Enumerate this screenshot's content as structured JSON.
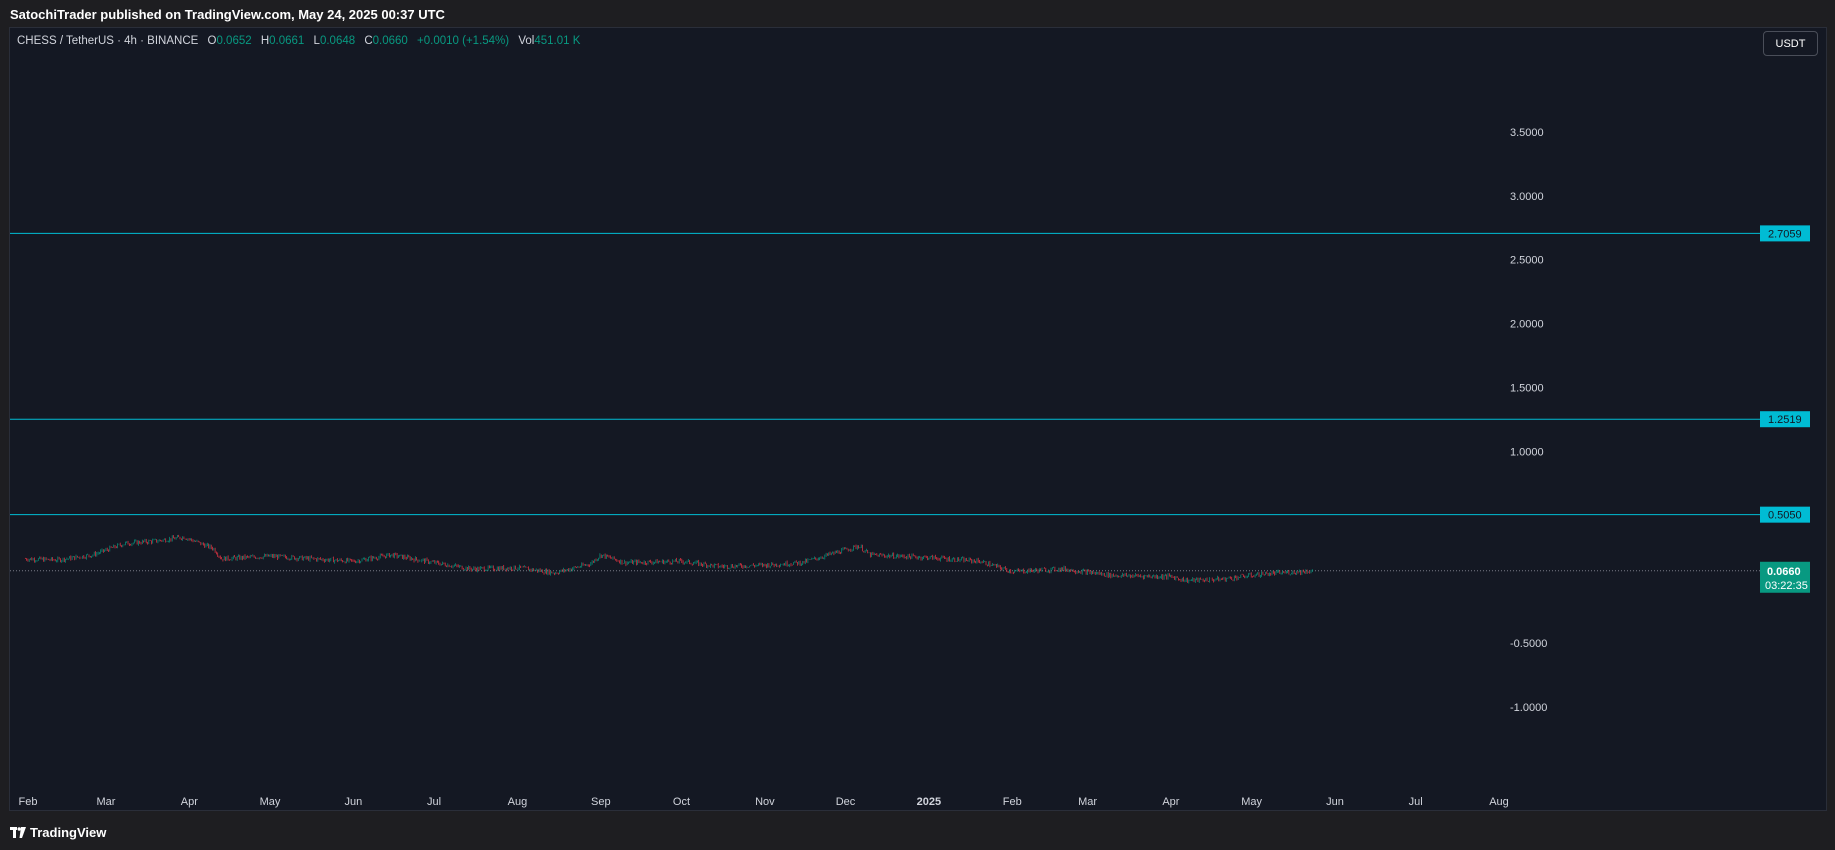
{
  "header": {
    "published": "SatochiTrader published on TradingView.com, May 24, 2025 00:37 UTC"
  },
  "legend": {
    "symbol": "CHESS / TetherUS · 4h · BINANCE",
    "open_label": "O",
    "open": "0.0652",
    "high_label": "H",
    "high": "0.0661",
    "low_label": "L",
    "low": "0.0648",
    "close_label": "C",
    "close": "0.0660",
    "change": "+0.0010 (+1.54%)",
    "vol_label": "Vol",
    "vol": "451.01 K"
  },
  "currency": "USDT",
  "footer": {
    "brand": "TradingView"
  },
  "colors": {
    "up": "#089981",
    "down": "#f23645",
    "level_line": "#00bcd4",
    "background": "#141823"
  },
  "chart_data": {
    "type": "candlestick",
    "title": "CHESS / TetherUS · 4h · BINANCE",
    "ylim": [
      -1.25,
      3.65
    ],
    "y_ticks": [
      "3.5000",
      "3.0000",
      "2.5000",
      "2.0000",
      "1.5000",
      "1.0000",
      "-0.5000",
      "-1.0000"
    ],
    "y_tick_values": [
      3.5,
      3.0,
      2.5,
      2.0,
      1.5,
      1.0,
      -0.5,
      -1.0
    ],
    "x_ticks": [
      "Feb",
      "Mar",
      "Apr",
      "May",
      "Jun",
      "Jul",
      "Aug",
      "Sep",
      "Oct",
      "Nov",
      "Dec",
      "2025",
      "Feb",
      "Mar",
      "Apr",
      "May",
      "Jun",
      "Jul",
      "Aug"
    ],
    "x_tick_dates": [
      "2024-02-01",
      "2024-03-01",
      "2024-04-01",
      "2024-05-01",
      "2024-06-01",
      "2024-07-01",
      "2024-08-01",
      "2024-09-01",
      "2024-10-01",
      "2024-11-01",
      "2024-12-01",
      "2025-01-01",
      "2025-02-01",
      "2025-03-01",
      "2025-04-01",
      "2025-05-01",
      "2025-06-01",
      "2025-07-01",
      "2025-08-01"
    ],
    "horizontal_levels": [
      {
        "label": "2.7059",
        "value": 2.7059
      },
      {
        "label": "1.2519",
        "value": 1.2519
      },
      {
        "label": "0.5050",
        "value": 0.505
      }
    ],
    "last_price": {
      "label": "0.0660",
      "value": 0.066,
      "countdown": "03:22:35"
    },
    "price_path": [
      {
        "date": "2024-01-31",
        "price": 0.16
      },
      {
        "date": "2024-02-12",
        "price": 0.15
      },
      {
        "date": "2024-02-25",
        "price": 0.19
      },
      {
        "date": "2024-03-08",
        "price": 0.28
      },
      {
        "date": "2024-03-20",
        "price": 0.3
      },
      {
        "date": "2024-03-30",
        "price": 0.33
      },
      {
        "date": "2024-04-10",
        "price": 0.24
      },
      {
        "date": "2024-04-13",
        "price": 0.16
      },
      {
        "date": "2024-05-01",
        "price": 0.18
      },
      {
        "date": "2024-06-01",
        "price": 0.14
      },
      {
        "date": "2024-06-15",
        "price": 0.19
      },
      {
        "date": "2024-07-01",
        "price": 0.13
      },
      {
        "date": "2024-07-15",
        "price": 0.08
      },
      {
        "date": "2024-08-01",
        "price": 0.09
      },
      {
        "date": "2024-08-15",
        "price": 0.05
      },
      {
        "date": "2024-08-28",
        "price": 0.12
      },
      {
        "date": "2024-09-01",
        "price": 0.19
      },
      {
        "date": "2024-09-10",
        "price": 0.13
      },
      {
        "date": "2024-10-01",
        "price": 0.14
      },
      {
        "date": "2024-10-15",
        "price": 0.1
      },
      {
        "date": "2024-11-01",
        "price": 0.11
      },
      {
        "date": "2024-11-15",
        "price": 0.13
      },
      {
        "date": "2024-12-01",
        "price": 0.23
      },
      {
        "date": "2024-12-06",
        "price": 0.26
      },
      {
        "date": "2024-12-10",
        "price": 0.19
      },
      {
        "date": "2025-01-01",
        "price": 0.17
      },
      {
        "date": "2025-01-20",
        "price": 0.14
      },
      {
        "date": "2025-02-01",
        "price": 0.06
      },
      {
        "date": "2025-02-20",
        "price": 0.08
      },
      {
        "date": "2025-03-10",
        "price": 0.03
      },
      {
        "date": "2025-04-01",
        "price": 0.02
      },
      {
        "date": "2025-04-07",
        "price": -0.01
      },
      {
        "date": "2025-04-20",
        "price": 0.0
      },
      {
        "date": "2025-05-05",
        "price": 0.04
      },
      {
        "date": "2025-05-24",
        "price": 0.066
      }
    ]
  }
}
